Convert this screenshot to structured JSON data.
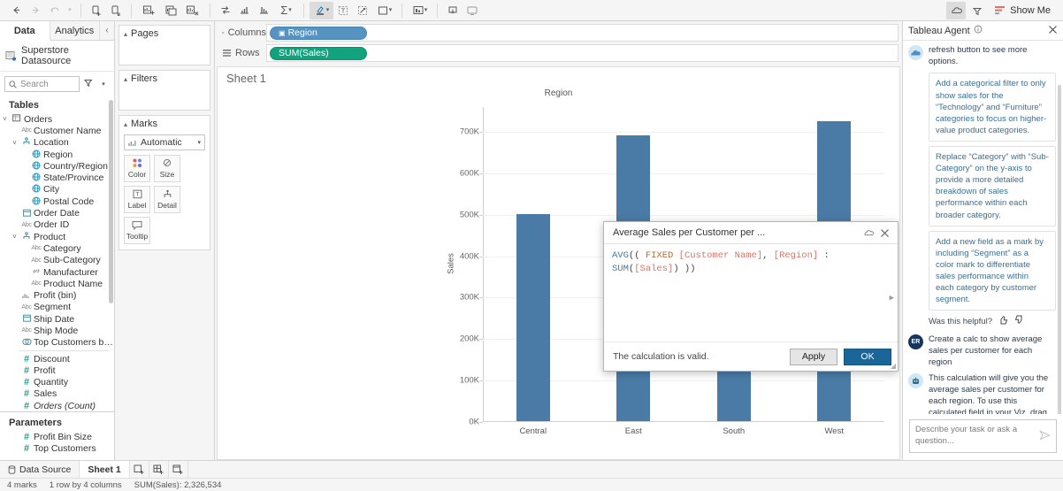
{
  "toolbar": {
    "buttons": [
      {
        "name": "back",
        "glyph": "←",
        "state": "enabled"
      },
      {
        "name": "forward",
        "glyph": "→",
        "state": "disabled"
      },
      {
        "name": "undo-redo",
        "glyph": "↺",
        "state": "disabled"
      },
      {
        "name": "dropdown",
        "glyph": "▾",
        "state": "disabled"
      },
      {
        "name": "new-data-source",
        "glyph": "⧉",
        "state": "enabled"
      },
      {
        "name": "pause-auto-update",
        "glyph": "⧉",
        "state": "enabled"
      },
      {
        "name": "new-worksheet",
        "glyph": "▦",
        "state": "enabled"
      },
      {
        "name": "duplicate-sheet",
        "glyph": "▤",
        "state": "enabled"
      },
      {
        "name": "clear-sheet",
        "glyph": "▥",
        "state": "enabled"
      },
      {
        "name": "swap-rows-columns",
        "glyph": "⇄",
        "state": "enabled"
      },
      {
        "name": "sort-ascending",
        "glyph": "↑",
        "state": "enabled"
      },
      {
        "name": "sort-descending",
        "glyph": "↓",
        "state": "enabled"
      },
      {
        "name": "totals",
        "glyph": "Σ",
        "state": "enabled"
      },
      {
        "name": "highlighter",
        "glyph": "✐",
        "state": "active"
      },
      {
        "name": "show-labels",
        "glyph": "T",
        "state": "enabled"
      },
      {
        "name": "fix-axes",
        "glyph": "↗",
        "state": "enabled"
      },
      {
        "name": "fit",
        "glyph": "▭",
        "state": "enabled"
      },
      {
        "name": "presentation-mode",
        "glyph": "▦",
        "state": "enabled"
      },
      {
        "name": "download",
        "glyph": "⤓",
        "state": "enabled"
      },
      {
        "name": "device-preview",
        "glyph": "▭",
        "state": "enabled"
      }
    ],
    "right": {
      "agent_toggle": "tableau-agent-icon",
      "lightning_icon": "highlight-icon",
      "show_me_label": "Show Me"
    }
  },
  "data_pane": {
    "tabs": [
      {
        "label": "Data",
        "selected": true
      },
      {
        "label": "Analytics",
        "selected": false
      }
    ],
    "collapse_glyph": "‹",
    "datasource": "Superstore Datasource",
    "search_placeholder": "Search",
    "filter_icon": "funnel-icon",
    "menu_icon": "chevron-down-icon",
    "sections": [
      {
        "heading": "Tables",
        "items": [
          {
            "label": "Orders",
            "icon": "table",
            "indent": 0,
            "caret": "˅"
          },
          {
            "label": "Customer Name",
            "icon": "abc",
            "indent": 1
          },
          {
            "label": "Location",
            "icon": "group",
            "indent": 1,
            "caret": "˅"
          },
          {
            "label": "Region",
            "icon": "geo",
            "indent": 2
          },
          {
            "label": "Country/Region",
            "icon": "geo",
            "indent": 2
          },
          {
            "label": "State/Province",
            "icon": "geo",
            "indent": 2
          },
          {
            "label": "City",
            "icon": "geo",
            "indent": 2
          },
          {
            "label": "Postal Code",
            "icon": "geo",
            "indent": 2
          },
          {
            "label": "Order Date",
            "icon": "date",
            "indent": 1
          },
          {
            "label": "Order ID",
            "icon": "abc",
            "indent": 1
          },
          {
            "label": "Product",
            "icon": "group",
            "indent": 1,
            "caret": "˅"
          },
          {
            "label": "Category",
            "icon": "abc",
            "indent": 2
          },
          {
            "label": "Sub-Category",
            "icon": "abc",
            "indent": 2
          },
          {
            "label": "Manufacturer",
            "icon": "link",
            "indent": 2
          },
          {
            "label": "Product Name",
            "icon": "abc",
            "indent": 2
          },
          {
            "label": "Profit (bin)",
            "icon": "bin",
            "indent": 1
          },
          {
            "label": "Segment",
            "icon": "abc",
            "indent": 1
          },
          {
            "label": "Ship Date",
            "icon": "date",
            "indent": 1
          },
          {
            "label": "Ship Mode",
            "icon": "abc",
            "indent": 1
          },
          {
            "label": "Top Customers by P...",
            "icon": "set",
            "indent": 1
          },
          {
            "label": "Discount",
            "icon": "num",
            "indent": 1,
            "divider_before": true
          },
          {
            "label": "Profit",
            "icon": "num",
            "indent": 1
          },
          {
            "label": "Quantity",
            "icon": "num",
            "indent": 1
          },
          {
            "label": "Sales",
            "icon": "num",
            "indent": 1
          },
          {
            "label": "Orders (Count)",
            "icon": "num",
            "indent": 1,
            "italic": true
          }
        ]
      },
      {
        "heading": "Parameters",
        "items": [
          {
            "label": "Profit Bin Size",
            "icon": "num",
            "indent": 1
          },
          {
            "label": "Top Customers",
            "icon": "num",
            "indent": 1
          }
        ]
      }
    ]
  },
  "shelf_column": {
    "pages": {
      "title": "Pages"
    },
    "filters": {
      "title": "Filters"
    },
    "marks": {
      "title": "Marks",
      "type": "Automatic",
      "buttons": [
        {
          "label": "Color",
          "icon": "color-icon"
        },
        {
          "label": "Size",
          "icon": "size-icon"
        },
        {
          "label": "Label",
          "icon": "label-icon"
        },
        {
          "label": "Detail",
          "icon": "detail-icon"
        },
        {
          "label": "Tooltip",
          "icon": "tooltip-icon"
        }
      ]
    }
  },
  "shelves": {
    "columns_label": "Columns",
    "columns_pill": "Region",
    "rows_label": "Rows",
    "rows_pill": "SUM(Sales)"
  },
  "sheet": {
    "title": "Sheet 1"
  },
  "chart_data": {
    "type": "bar",
    "title": "Region",
    "categories": [
      "Central",
      "East",
      "South",
      "West"
    ],
    "values": [
      501240,
      691990,
      391720,
      725460
    ],
    "xlabel": "Region",
    "ylabel": "Sales",
    "ylim": [
      0,
      760000
    ],
    "yticks": [
      0,
      100000,
      200000,
      300000,
      400000,
      500000,
      600000,
      700000
    ],
    "ytick_labels": [
      "0K",
      "100K",
      "200K",
      "300K",
      "400K",
      "500K",
      "600K",
      "700K"
    ],
    "series_color": "#4a7ba7",
    "grid": true,
    "legend": "none"
  },
  "calc_dialog": {
    "title": "Average Sales per Customer per ...",
    "help_icon": "tableau-help-icon",
    "close_icon": "close-icon",
    "formula_tokens": [
      {
        "text": "AVG",
        "kind": "fn"
      },
      {
        "text": "(( ",
        "kind": "plain"
      },
      {
        "text": "FIXED",
        "kind": "kw"
      },
      {
        "text": " ",
        "kind": "plain"
      },
      {
        "text": "[Customer Name]",
        "kind": "fld"
      },
      {
        "text": ", ",
        "kind": "plain"
      },
      {
        "text": "[Region]",
        "kind": "fld"
      },
      {
        "text": " : ",
        "kind": "plain"
      },
      {
        "text": "SUM",
        "kind": "fn"
      },
      {
        "text": "(",
        "kind": "plain"
      },
      {
        "text": "[Sales]",
        "kind": "fld"
      },
      {
        "text": ") ))",
        "kind": "plain"
      }
    ],
    "status": "The calculation is valid.",
    "apply_label": "Apply",
    "ok_label": "OK"
  },
  "agent": {
    "title": "Tableau Agent",
    "info_icon": "info-icon",
    "close_icon": "close-icon",
    "intro_fragment": "refresh button to see more options.",
    "suggestions": [
      "Add a categorical filter to only show sales for the “Technology” and “Furniture” categories to focus on higher-value product categories.",
      "Replace “Category” with “Sub-Category” on the y-axis to provide a more detailed breakdown of sales performance within each broader category.",
      "Add a new field as a mark by including “Segment” as a color mark to differentiate sales performance within each category by customer segment."
    ],
    "helpful_label": "Was this helpful?",
    "thumb_up_icon": "thumbs-up-icon",
    "thumb_down_icon": "thumbs-down-icon",
    "user_avatar_initials": "ER",
    "user_message": "Create a calc to show average sales per customer for each region",
    "bot_message": "This calculation will give you the average sales per customer for each region. To use this calculated field in your Viz, drag 'Region' to the Rows shelf and the calculated field 'Average Sales per Customer per Region' to the Columns shelf.",
    "input_placeholder": "Describe your task or ask a question...",
    "send_icon": "send-icon"
  },
  "bottom": {
    "tabs": [
      {
        "label": "Data Source",
        "icon": "database-icon",
        "selected": false
      },
      {
        "label": "Sheet 1",
        "icon": "",
        "selected": true
      }
    ],
    "new_sheet_icon": "new-worksheet-icon",
    "new_dashboard_icon": "new-dashboard-icon",
    "new_story_icon": "new-story-icon",
    "status": {
      "marks": "4 marks",
      "dimensions": "1 row by 4 columns",
      "aggregate": "SUM(Sales): 2,326,534"
    }
  }
}
